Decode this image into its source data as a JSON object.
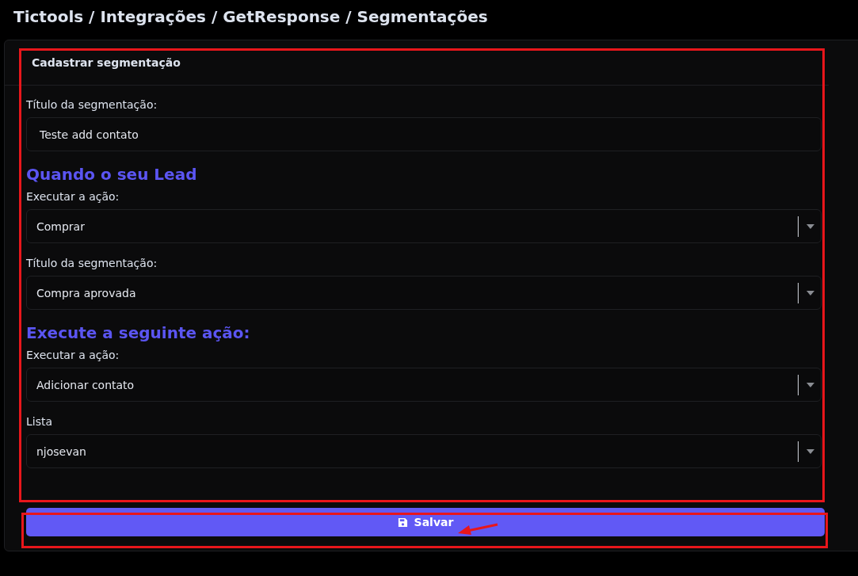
{
  "page_title": "Tictools / Integrações / GetResponse / Segmentações",
  "card": {
    "title": "Cadastrar segmentação",
    "items": [
      {
        "kind": "text",
        "label": "Título da segmentação:",
        "value": "Teste add contato"
      },
      {
        "kind": "heading",
        "text": "Quando o seu Lead"
      },
      {
        "kind": "select",
        "label": "Executar a ação:",
        "value": "Comprar"
      },
      {
        "kind": "select",
        "label": "Título da segmentação:",
        "value": "Compra aprovada"
      },
      {
        "kind": "heading",
        "text": "Execute a seguinte ação:"
      },
      {
        "kind": "select",
        "label": "Executar a ação:",
        "value": "Adicionar contato"
      },
      {
        "kind": "select",
        "label": "Lista",
        "value": "njosevan"
      }
    ]
  },
  "save_button": {
    "label": "Salvar"
  }
}
